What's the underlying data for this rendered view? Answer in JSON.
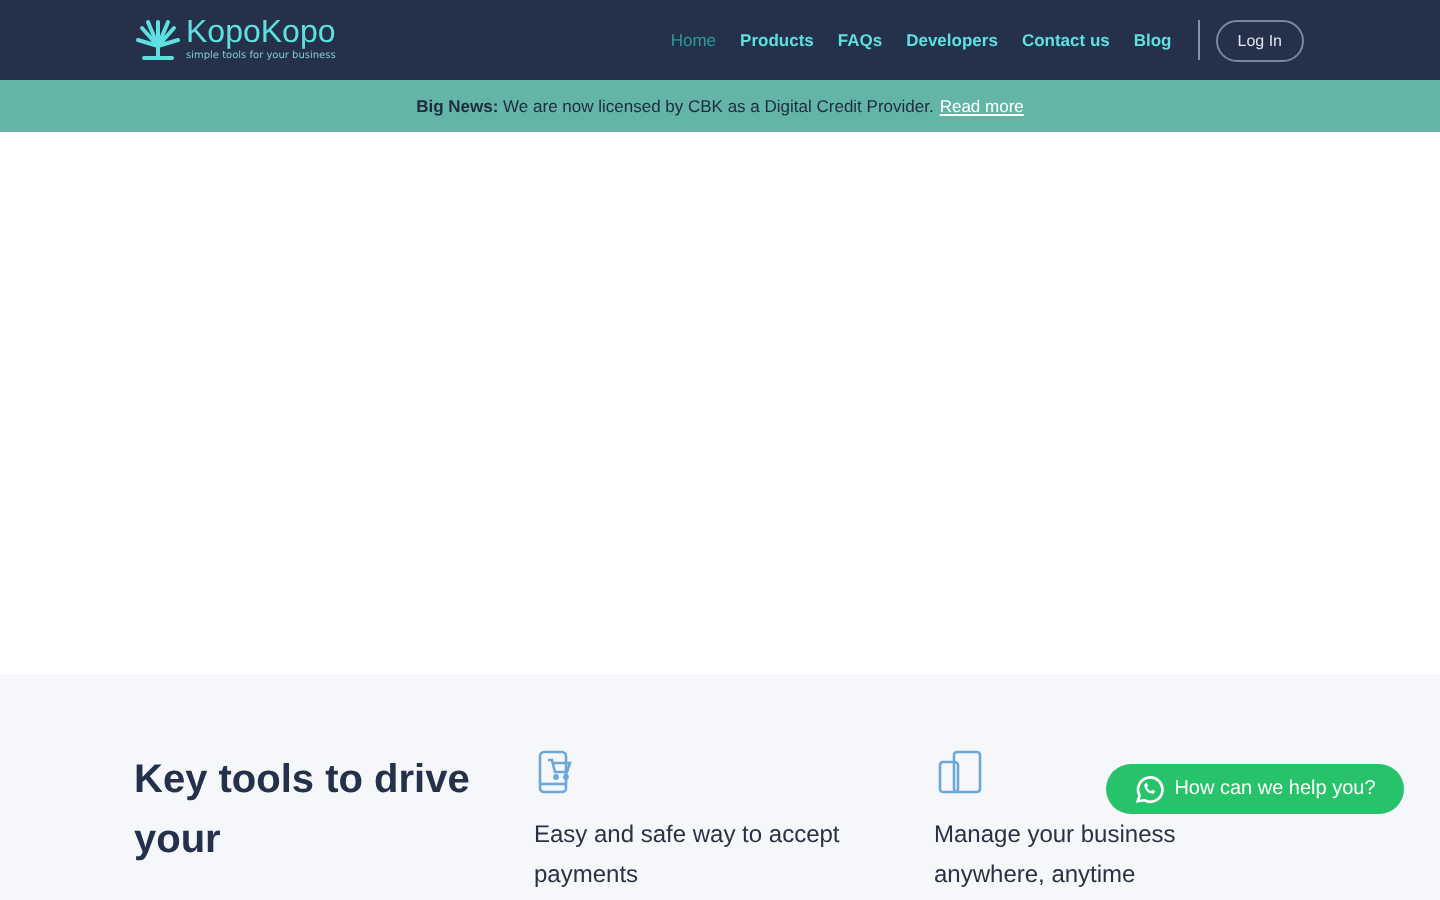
{
  "header": {
    "logo": {
      "name": "KopoKopo",
      "tagline": "simple tools for your business"
    },
    "nav": [
      {
        "label": "Home",
        "selected": true
      },
      {
        "label": "Products",
        "selected": false
      },
      {
        "label": "FAQs",
        "selected": false
      },
      {
        "label": "Developers",
        "selected": false
      },
      {
        "label": "Contact us",
        "selected": false
      },
      {
        "label": "Blog",
        "selected": false
      }
    ],
    "login": "Log In"
  },
  "banner": {
    "text": "**Big News:** We are now licensed by CBK as a Digital Credit Provider.",
    "link": "Read more"
  },
  "features": {
    "heading": "Key tools to drive your",
    "items": [
      {
        "kind": "cart",
        "text": "Easy and safe way to accept payments"
      },
      {
        "kind": "devices",
        "text": "Manage your business anywhere, anytime"
      }
    ]
  },
  "chat_button": "How can we help you?"
}
